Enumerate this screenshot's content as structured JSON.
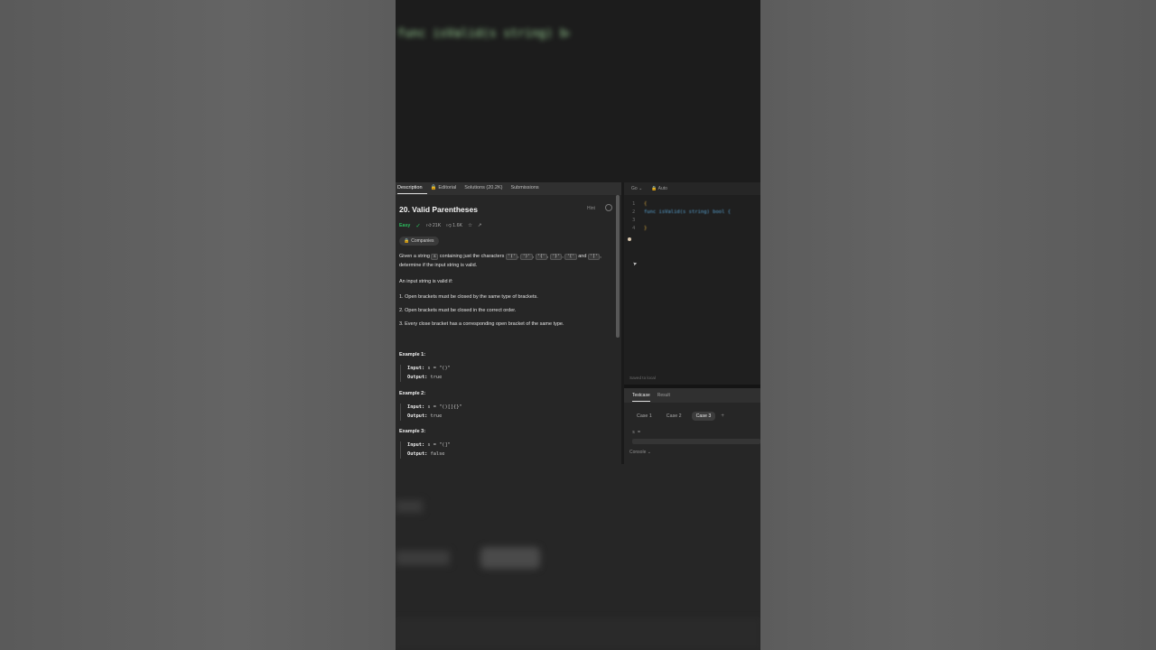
{
  "problem_tabs": [
    {
      "label": "Description",
      "locked": false,
      "active": true
    },
    {
      "label": "Editorial",
      "locked": true,
      "active": false
    },
    {
      "label": "Solutions (20.2K)",
      "locked": false,
      "active": false
    },
    {
      "label": "Submissions",
      "locked": false,
      "active": false
    }
  ],
  "problem": {
    "title": "20. Valid Parentheses",
    "hint": "Hint",
    "difficulty": "Easy",
    "likes": "21K",
    "dislikes": "1.6K",
    "companies": "Companies",
    "desc_part1": "Given a string",
    "desc_var": "s",
    "desc_part2": "containing just the characters",
    "chars": [
      "'('",
      "')'",
      "'{'",
      "'}'",
      "'['",
      "']'"
    ],
    "desc_and": "and",
    "desc_part3": ", determine if the input string is valid.",
    "valid_if": "An input string is valid if:",
    "rules": [
      "1. Open brackets must be closed by the same type of brackets.",
      "2. Open brackets must be closed in the correct order.",
      "3. Every close bracket has a corresponding open bracket of the same type."
    ]
  },
  "examples": [
    {
      "title": "Example 1:",
      "input_label": "Input:",
      "input": "s = \"()\"",
      "output_label": "Output:",
      "output": "true"
    },
    {
      "title": "Example 2:",
      "input_label": "Input:",
      "input": "s = \"()[]{}\"",
      "output_label": "Output:",
      "output": "true"
    },
    {
      "title": "Example 3:",
      "input_label": "Input:",
      "input": "s = \"(]\"",
      "output_label": "Output:",
      "output": "false"
    }
  ],
  "editor": {
    "language": "Go",
    "mode": "Auto",
    "lines": [
      {
        "num": "1",
        "text": "{"
      },
      {
        "num": "2",
        "text": "func isValid(s string) bool {"
      },
      {
        "num": "3",
        "text": ""
      },
      {
        "num": "4",
        "text": "}"
      }
    ],
    "saved": "Saved to local"
  },
  "testpanel": {
    "tabs": [
      "Testcase",
      "Result"
    ],
    "cases": [
      "Case 1",
      "Case 2",
      "Case 3"
    ],
    "active_case": 2,
    "s_label": "s =",
    "console": "Console"
  },
  "blurred_code": "func isValid(s string) bool {"
}
